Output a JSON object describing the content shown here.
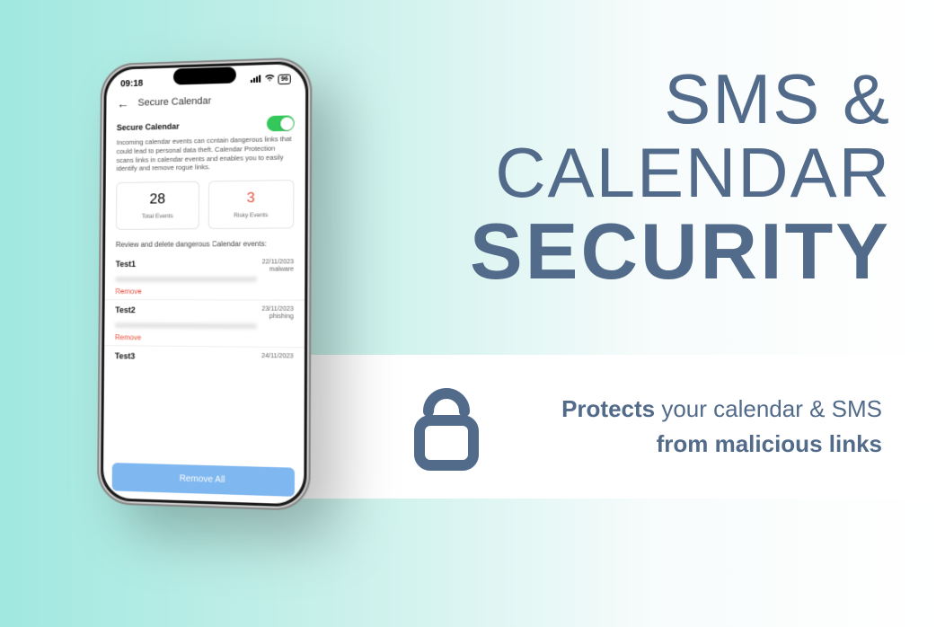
{
  "headline": {
    "line1": "SMS &",
    "line2": "CALENDAR",
    "line3": "SECURITY"
  },
  "banner": {
    "text_bold1": "Protects",
    "text_rest1": " your calendar & SMS",
    "text_bold2": "from malicious links"
  },
  "phone": {
    "status": {
      "time": "09:18",
      "battery": "96"
    },
    "header_title": "Secure Calendar",
    "section_label": "Secure Calendar",
    "toggle_on": true,
    "description": "Incoming calendar events can contain dangerous links that could lead to personal data theft. Calendar Protection scans links in calendar events and enables you to easily identify and remove rogue links.",
    "stats": {
      "total": {
        "value": "28",
        "label": "Total Events"
      },
      "risky": {
        "value": "3",
        "label": "Risky Events"
      }
    },
    "review_label": "Review and delete dangerous Calendar events:",
    "events": [
      {
        "name": "Test1",
        "date": "22/11/2023",
        "type": "malware",
        "remove_label": "Remove"
      },
      {
        "name": "Test2",
        "date": "23/11/2023",
        "type": "phishing",
        "remove_label": "Remove"
      },
      {
        "name": "Test3",
        "date": "24/11/2023",
        "type": "",
        "remove_label": ""
      }
    ],
    "remove_all_label": "Remove All"
  },
  "colors": {
    "brand_slate": "#526b8a",
    "toggle_green": "#34c759",
    "danger": "#e74c3c",
    "button_blue": "#7fb7f0"
  }
}
